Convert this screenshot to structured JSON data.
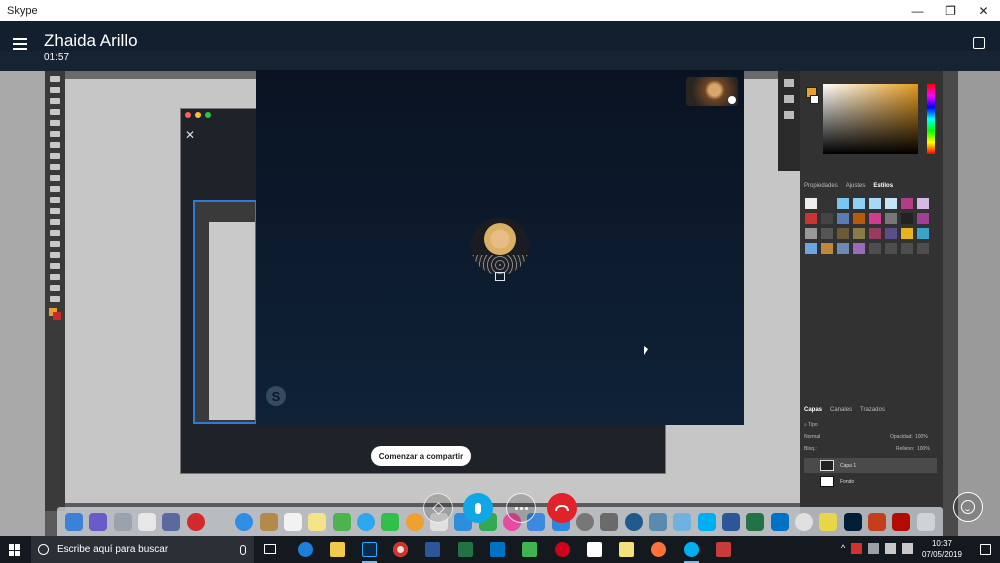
{
  "window": {
    "title": "Skype",
    "minimize_glyph": "—",
    "maximize_glyph": "❐",
    "close_glyph": "✕"
  },
  "call": {
    "contact_name": "Zhaida Arillo",
    "duration": "01:57"
  },
  "share": {
    "button_label": "Comenzar a compartir"
  },
  "photoshop": {
    "panel_tabs": [
      "Propiedades",
      "Ajustes",
      "Estilos"
    ],
    "active_panel_tab": "Estilos",
    "layers_tabs": [
      "Capas",
      "Canales",
      "Trazados"
    ],
    "active_layers_tab": "Capas",
    "kind_filter": "Tipo",
    "blend_mode": "Normal",
    "opacity_label": "Opacidad:",
    "opacity_value": "100%",
    "fill_label": "Relleno:",
    "fill_value": "100%",
    "lock_label": "Bloq.:",
    "layers": [
      {
        "name": "Capa 1"
      },
      {
        "name": "Fondo"
      }
    ],
    "foreground_color": "#e5a02f",
    "background_color": "#ffffff"
  },
  "taskbar": {
    "search_placeholder": "Escribe aquí para buscar",
    "time": "10:37",
    "date": "07/05/2019",
    "apps": [
      "edge-icon",
      "file-explorer-icon",
      "photoshop-icon",
      "chrome-icon",
      "word-icon",
      "excel-icon",
      "outlook-icon",
      "camtasia-icon",
      "opera-icon",
      "notepad-icon",
      "sticky-notes-icon",
      "firefox-icon",
      "skype-icon",
      "snipping-icon"
    ]
  },
  "colors": {
    "skype_blue": "#11a6e6",
    "hangup_red": "#e2222b",
    "call_header": "#0a1a2c"
  }
}
